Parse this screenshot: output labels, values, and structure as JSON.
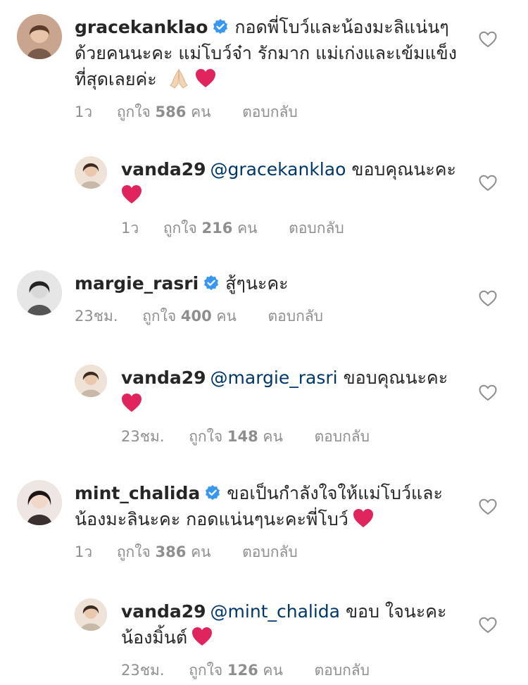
{
  "comments": [
    {
      "id": "c1",
      "username": "gracekanklao",
      "verified": true,
      "mention": "",
      "text": "กอดพี่โบว์และน้องมะลิแน่นๆ ด้วยคนนะคะ แม่โบว์จ๋า รักมาก แม่เก่งและเข้มแข็งที่สุดเลยค่ะ",
      "emojis": [
        "pray-emoji",
        "heart-emoji"
      ],
      "time": "1ว",
      "likes_prefix": "ถูกใจ",
      "likes_count": "586",
      "likes_suffix": "คน",
      "reply_label": "ตอบกลับ"
    },
    {
      "id": "r1",
      "username": "vanda29",
      "verified": false,
      "mention": "@gracekanklao",
      "text": "ขอบคุณนะคะ",
      "emojis": [
        "heart-emoji"
      ],
      "time": "1ว",
      "likes_prefix": "ถูกใจ",
      "likes_count": "216",
      "likes_suffix": "คน",
      "reply_label": "ตอบกลับ"
    },
    {
      "id": "c2",
      "username": "margie_rasri",
      "verified": true,
      "mention": "",
      "text": "สู้ๆนะคะ",
      "emojis": [],
      "time": "23ชม.",
      "likes_prefix": "ถูกใจ",
      "likes_count": "400",
      "likes_suffix": "คน",
      "reply_label": "ตอบกลับ"
    },
    {
      "id": "r2",
      "username": "vanda29",
      "verified": false,
      "mention": "@margie_rasri",
      "text": "ขอบคุณนะคะ",
      "emojis": [
        "heart-emoji"
      ],
      "time": "23ชม.",
      "likes_prefix": "ถูกใจ",
      "likes_count": "148",
      "likes_suffix": "คน",
      "reply_label": "ตอบกลับ"
    },
    {
      "id": "c3",
      "username": "mint_chalida",
      "verified": true,
      "mention": "",
      "text": "ขอเป็นกำลังใจให้แม่โบว์และน้องมะลินะคะ กอดแน่นๆนะคะพี่โบว์",
      "emojis": [
        "heart-emoji"
      ],
      "time": "1ว",
      "likes_prefix": "ถูกใจ",
      "likes_count": "386",
      "likes_suffix": "คน",
      "reply_label": "ตอบกลับ"
    },
    {
      "id": "r3",
      "username": "vanda29",
      "verified": false,
      "mention": "@mint_chalida",
      "text": "ขอบ ใจนะคะ น้องมิ้นต์",
      "emojis": [
        "heart-emoji"
      ],
      "time": "23ชม.",
      "likes_prefix": "ถูกใจ",
      "likes_count": "126",
      "likes_suffix": "คน",
      "reply_label": "ตอบกลับ"
    }
  ],
  "colors": {
    "text": "#262626",
    "meta": "#8e8e8e",
    "mention": "#00376b",
    "verified": "#3897f0",
    "heart": "#e0245e"
  }
}
